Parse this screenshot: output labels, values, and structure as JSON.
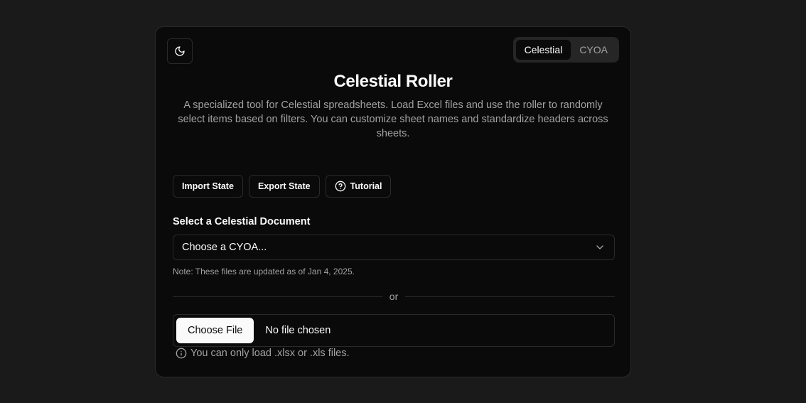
{
  "mode_toggle": {
    "options": [
      "Celestial",
      "CYOA"
    ],
    "active": "Celestial"
  },
  "theme_icon": "moon-icon",
  "title": "Celestial Roller",
  "description": "A specialized tool for Celestial spreadsheets. Load Excel files and use the roller to randomly select items based on filters. You can customize sheet names and standardize headers across sheets.",
  "actions": {
    "import_label": "Import State",
    "export_label": "Export State",
    "tutorial_label": "Tutorial",
    "tutorial_icon": "help-circle-icon"
  },
  "document_select": {
    "label": "Select a Celestial Document",
    "placeholder": "Choose a CYOA...",
    "note": "Note: These files are updated as of Jan 4, 2025."
  },
  "divider_text": "or",
  "file_input": {
    "button_label": "Choose File",
    "status": "No file chosen",
    "hint": "You can only load .xlsx or .xls files.",
    "hint_icon": "info-icon"
  },
  "colors": {
    "background": "#1a1a1a",
    "card": "#0a0a0a",
    "border": "#2a2a2a",
    "muted_text": "#a3a3a3",
    "primary_text": "#fafafa"
  }
}
